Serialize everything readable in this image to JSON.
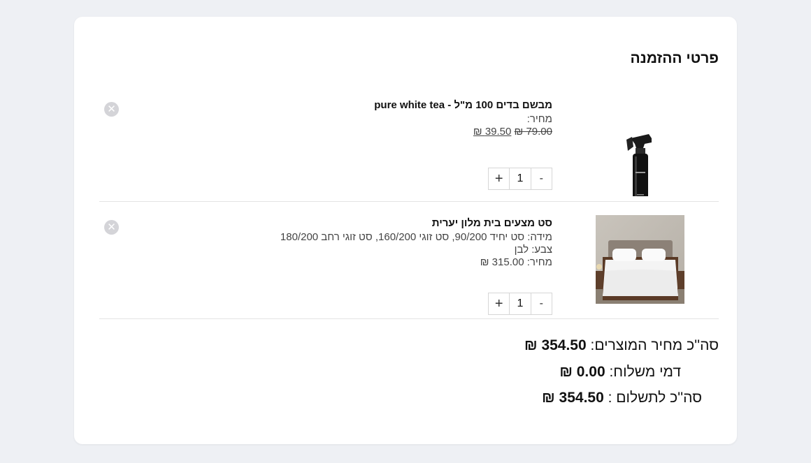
{
  "order": {
    "title": "פרטי ההזמנה",
    "items": [
      {
        "name": "מבשם בדים 100 מ\"ל - pure white tea",
        "price_label": "מחיר:",
        "old_price": "79.00 ₪",
        "new_price": "39.50 ₪",
        "quantity": "1",
        "plus": "+",
        "minus": "-",
        "remove": "✕",
        "image": "spray-bottle-image"
      },
      {
        "name": "סט מצעים בית מלון יערית",
        "size_line": "מידה: סט יחיד 90/200, סט זוגי 160/200, סט זוגי רחב 180/200",
        "color_line": "צבע: לבן",
        "price_line": "מחיר: 315.00 ₪",
        "quantity": "1",
        "plus": "+",
        "minus": "-",
        "remove": "✕",
        "image": "bedding-image"
      }
    ],
    "totals": {
      "products_label": "סה''כ מחיר המוצרים:",
      "products_value": "354.50 ₪",
      "shipping_label": "דמי משלוח:",
      "shipping_value": "0.00 ₪",
      "payment_label": "סה''כ לתשלום :",
      "payment_value": "354.50 ₪"
    }
  }
}
